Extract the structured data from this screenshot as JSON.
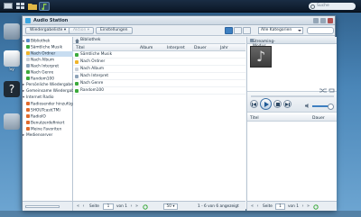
{
  "taskbar": {
    "search_placeholder": "Suche"
  },
  "desktop_icons": [
    {
      "label": "",
      "icon": "package-icon"
    },
    {
      "label": "Sy",
      "icon": "system-icon"
    },
    {
      "label": "",
      "icon": "help-icon"
    },
    {
      "label": "",
      "icon": "audio-icon"
    }
  ],
  "window": {
    "title": "Audio Station"
  },
  "toolbar": {
    "playlist_label": "Wiedergabeliste",
    "action_label": "Aktion",
    "settings_label": "Einstellungen",
    "category_value": "Alle Kategorien"
  },
  "tree": {
    "library": "Bibliothek",
    "items": [
      {
        "label": "Sämtliche Musik"
      },
      {
        "label": "Nach Ordner"
      },
      {
        "label": "Nach Album"
      },
      {
        "label": "Nach Interpret"
      },
      {
        "label": "Nach Genre"
      },
      {
        "label": "Random100"
      }
    ],
    "personal_playlist": "Persönliche Wiedergabelis",
    "shared_playlist": "Gemeinsame Wiedergabeli",
    "internet_radio": "Internet Radio",
    "radio_items": [
      {
        "label": "Radiosender hinzufüge"
      },
      {
        "label": "SHOUTcast(TM)"
      },
      {
        "label": "RadioIO"
      },
      {
        "label": "Benutzerdefiniert"
      },
      {
        "label": "Meine Favoriten"
      }
    ],
    "media_server": "Medienserver"
  },
  "center": {
    "breadcrumb": "Bibliothek",
    "columns": [
      "Titel",
      "Album",
      "Interpret",
      "Dauer",
      "Jahr"
    ],
    "rows": [
      {
        "title": "Sämtliche Musik"
      },
      {
        "title": "Nach Ordner"
      },
      {
        "title": "Nach Album"
      },
      {
        "title": "Nach Interpret"
      },
      {
        "title": "Nach Genre"
      },
      {
        "title": "Random100"
      }
    ],
    "pager": {
      "page_label": "Seite",
      "page_value": "1",
      "of_label": "von 1",
      "page_size": "50",
      "range": "1 - 6 von 6 angezeigt"
    }
  },
  "right": {
    "mode": "Streaming-Modus",
    "columns": [
      "Titel",
      "Dauer"
    ],
    "pager": {
      "page_label": "Seite",
      "page_value": "1",
      "of_label": "von 1"
    }
  },
  "colors": {
    "accent": "#3d7fc1",
    "folder": "#f0b429",
    "green": "#3caa3c"
  }
}
